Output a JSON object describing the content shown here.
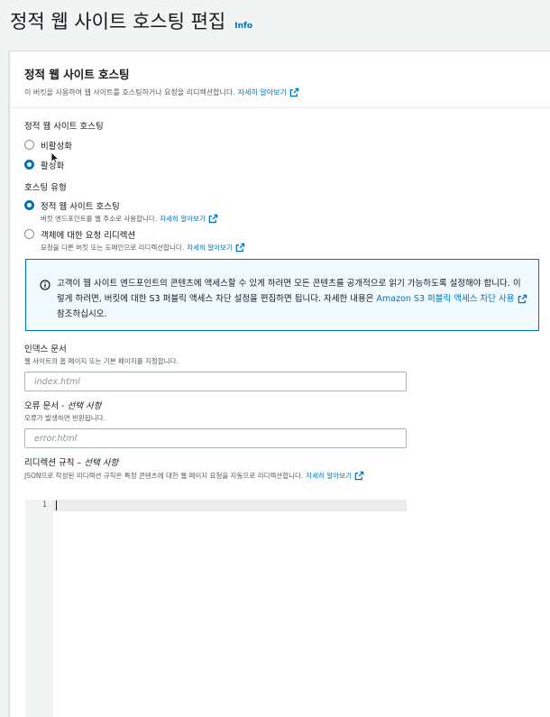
{
  "page": {
    "title": "정적 웹 사이트 호스팅 편집",
    "info_label": "Info"
  },
  "panel": {
    "title": "정적 웹 사이트 호스팅",
    "description": "이 버킷을 사용하여 웹 사이트를 호스팅하거나 요청을 리디렉션합니다.",
    "learn_more": "자세히 알아보기"
  },
  "hosting": {
    "label": "정적 웹 사이트 호스팅",
    "options": [
      {
        "label": "비활성화",
        "checked": false
      },
      {
        "label": "활성화",
        "checked": true
      }
    ]
  },
  "hosting_type": {
    "label": "호스팅 유형",
    "options": [
      {
        "label": "정적 웹 사이트 호스팅",
        "description": "버킷 엔드포인트를 웹 주소로 사용합니다.",
        "link": "자세히 알아보기",
        "checked": true
      },
      {
        "label": "객체에 대한 요청 리디렉션",
        "description": "요청을 다른 버킷 또는 도메인으로 리디렉션합니다.",
        "link": "자세히 알아보기",
        "checked": false
      }
    ]
  },
  "alert": {
    "text_1": "고객이 웹 사이트 엔드포인트의 콘텐츠에 액세스할 수 있게 하려면 모든 콘텐츠를 공개적으로 읽기 가능하도록 설정해야 합니다. 이렇게 하려면, 버킷에 대한 S3 퍼블릭 액세스 차단 설정을 편집하면 됩니다. 자세한 내용은 ",
    "link": "Amazon S3 퍼블릭 액세스 차단 사용",
    "text_2": " 참조하십시오."
  },
  "index_document": {
    "label": "인덱스 문서",
    "description": "웹 사이트의 홈 페이지 또는 기본 페이지를 지정합니다.",
    "placeholder": "index.html",
    "value": ""
  },
  "error_document": {
    "label": "오류 문서 - ",
    "optional": "선택 사항",
    "description": "오류가 발생하면 반환됩니다.",
    "placeholder": "error.html",
    "value": ""
  },
  "redirection_rules": {
    "label": "리디렉션 규칙 – ",
    "optional": "선택 사항",
    "description": "JSON으로 작성된 리디렉션 규칙은 특정 콘텐츠에 대한 웹 페이지 요청을 자동으로 리디렉션합니다.",
    "learn_more": "자세히 알아보기",
    "editor_line_number": "1",
    "editor_content": ""
  },
  "colors": {
    "link": "#0073bb",
    "selected_radio": "#0073bb",
    "alert_background": "#f1faff",
    "alert_border": "#0073bb",
    "page_background": "#f2f3f3"
  },
  "icons": {
    "external_link": "external-link-icon",
    "info": "info-circle-icon"
  }
}
